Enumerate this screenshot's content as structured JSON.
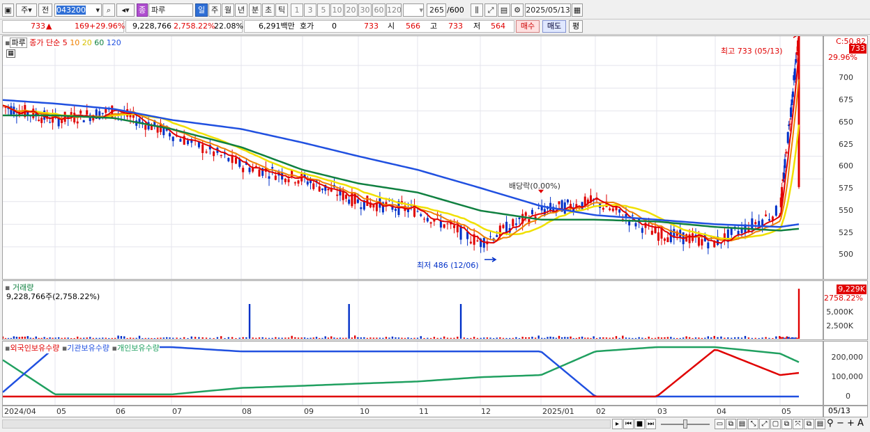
{
  "toolbar": {
    "market": "주",
    "prev": "전",
    "code": "043200",
    "name_badge": "종",
    "name": "파루",
    "periods": [
      "일",
      "주",
      "월",
      "년",
      "분",
      "초",
      "틱"
    ],
    "minutes": [
      "1",
      "3",
      "5",
      "10",
      "20",
      "30",
      "60",
      "120"
    ],
    "count": "265",
    "total": "/600",
    "date": "2025/05/13"
  },
  "quote": {
    "price": "733",
    "change": "169",
    "change_pct": "+29.96%",
    "volume": "9,228,766",
    "volume_ratio": "2,758.22%",
    "turnover_rate": "22.08%",
    "amount": "6,291백만",
    "hoga_label": "호가",
    "hoga_value": "0",
    "bid": "733",
    "open_label": "시",
    "open": "566",
    "high_label": "고",
    "high": "733",
    "low_label": "저",
    "low": "564",
    "buy_btn": "매수",
    "sell_btn": "매도",
    "avg_btn": "평"
  },
  "price_pane": {
    "title": "파루",
    "ma_label": "종가 단순",
    "ma_periods": [
      "5",
      "10",
      "20",
      "60",
      "120"
    ],
    "high_note": "최고 733 (05/13)",
    "low_note": "최저 486 (12/06)",
    "dividend_note": "배당락(0.00%)",
    "axis_top": "C:50.82",
    "axis_price": "733",
    "axis_pct": "29.96%",
    "y_ticks": [
      "700",
      "675",
      "650",
      "625",
      "600",
      "575",
      "550",
      "525",
      "500"
    ]
  },
  "volume_pane": {
    "title": "거래량",
    "value": "9,228,766주(2,758.22%)",
    "axis_value": "9,229K",
    "axis_pct": "2758.22%",
    "y_ticks": [
      "5,000K",
      "2,500K"
    ]
  },
  "holding_pane": {
    "legend": [
      "외국인보유수량",
      "기관보유수량",
      "개인보유수량"
    ],
    "y_ticks": [
      "200,000",
      "100,000",
      "0"
    ]
  },
  "x_ticks": [
    "2024/04",
    "05",
    "06",
    "07",
    "08",
    "09",
    "10",
    "11",
    "12",
    "2025/01",
    "02",
    "03",
    "04",
    "05",
    "05/13"
  ],
  "colors": {
    "up": "#e00000",
    "down": "#0030c8",
    "ma5": "#e00000",
    "ma10": "#f08000",
    "ma20": "#f0e000",
    "ma60": "#108040",
    "ma120": "#2050e0",
    "foreign": "#e00000",
    "inst": "#2050e0",
    "retail": "#20a060"
  },
  "chart_data": {
    "type": "line",
    "title": "파루",
    "ylim": [
      480,
      740
    ],
    "x": [
      "2024/04",
      "05",
      "06",
      "07",
      "08",
      "09",
      "10",
      "11",
      "12",
      "2025/01",
      "02",
      "03",
      "04",
      "05",
      "05/13"
    ],
    "series": [
      {
        "name": "종가",
        "values": [
          655,
          640,
          650,
          625,
          590,
          575,
          550,
          540,
          505,
          540,
          550,
          515,
          505,
          540,
          733
        ]
      },
      {
        "name": "120",
        "values": [
          662,
          658,
          652,
          640,
          630,
          615,
          600,
          585,
          565,
          545,
          535,
          530,
          525,
          522,
          525
        ]
      },
      {
        "name": "60",
        "values": [
          645,
          645,
          642,
          630,
          610,
          585,
          570,
          560,
          540,
          530,
          530,
          528,
          522,
          518,
          520
        ]
      }
    ],
    "holdings": {
      "categories": [
        "2024/04",
        "05",
        "06",
        "07",
        "08",
        "09",
        "10",
        "11",
        "12",
        "2025/01",
        "02",
        "03",
        "04",
        "05",
        "05/13"
      ],
      "series": [
        {
          "name": "외국인보유수량",
          "values": [
            0,
            0,
            0,
            0,
            0,
            0,
            0,
            0,
            0,
            0,
            0,
            0,
            220000,
            100000,
            110000
          ]
        },
        {
          "name": "기관보유수량",
          "values": [
            20000,
            230000,
            230000,
            230000,
            210000,
            210000,
            210000,
            210000,
            210000,
            210000,
            0,
            0,
            0,
            0,
            0
          ]
        },
        {
          "name": "개인보유수량",
          "values": [
            170000,
            10000,
            10000,
            10000,
            40000,
            50000,
            60000,
            70000,
            90000,
            100000,
            210000,
            230000,
            230000,
            200000,
            160000
          ]
        }
      ]
    }
  }
}
